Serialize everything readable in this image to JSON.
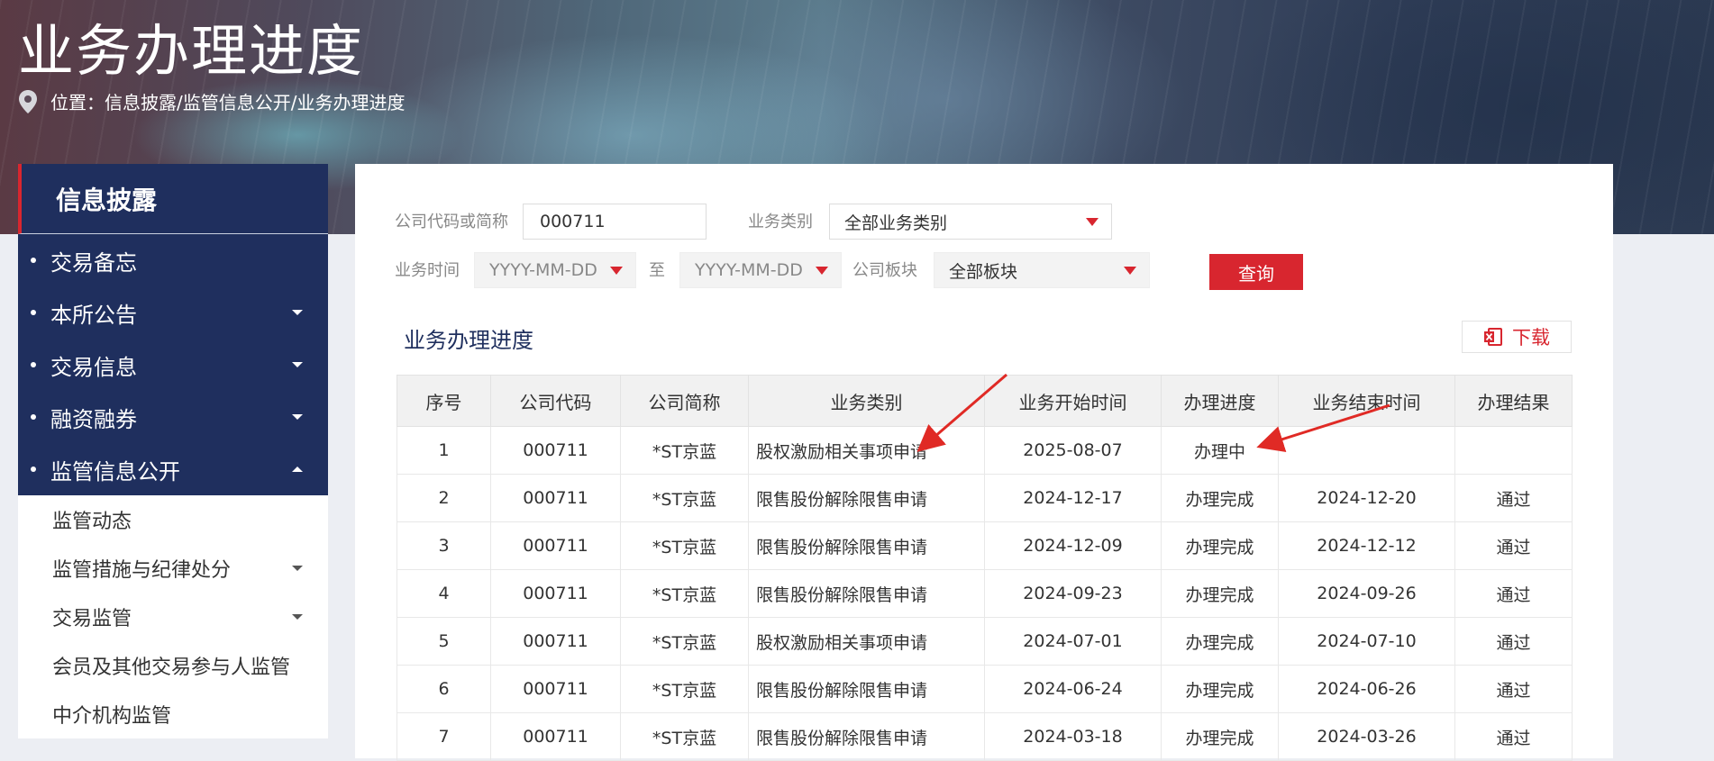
{
  "header": {
    "title": "业务办理进度",
    "breadcrumb": "位置：信息披露/监管信息公开/业务办理进度"
  },
  "sidebar": {
    "title": "信息披露",
    "items": [
      {
        "label": "交易备忘"
      },
      {
        "label": "本所公告"
      },
      {
        "label": "交易信息"
      },
      {
        "label": "融资融券"
      },
      {
        "label": "监管信息公开"
      }
    ],
    "subitems": [
      {
        "label": "监管动态"
      },
      {
        "label": "监管措施与纪律处分"
      },
      {
        "label": "交易监管"
      },
      {
        "label": "会员及其他交易参与人监管"
      },
      {
        "label": "中介机构监管"
      }
    ]
  },
  "filters": {
    "company_label": "公司代码或简称",
    "company_value": "000711",
    "type_label": "业务类别",
    "type_value": "全部业务类别",
    "time_label": "业务时间",
    "date_from_placeholder": "YYYY-MM-DD",
    "to_label": "至",
    "date_to_placeholder": "YYYY-MM-DD",
    "board_label": "公司板块",
    "board_value": "全部板块",
    "query_label": "查询"
  },
  "results": {
    "title": "业务办理进度",
    "download_label": "下载",
    "columns": [
      "序号",
      "公司代码",
      "公司简称",
      "业务类别",
      "业务开始时间",
      "办理进度",
      "业务结束时间",
      "办理结果"
    ],
    "rows": [
      [
        "1",
        "000711",
        "*ST京蓝",
        "股权激励相关事项申请",
        "2025-08-07",
        "办理中",
        "",
        ""
      ],
      [
        "2",
        "000711",
        "*ST京蓝",
        "限售股份解除限售申请",
        "2024-12-17",
        "办理完成",
        "2024-12-20",
        "通过"
      ],
      [
        "3",
        "000711",
        "*ST京蓝",
        "限售股份解除限售申请",
        "2024-12-09",
        "办理完成",
        "2024-12-12",
        "通过"
      ],
      [
        "4",
        "000711",
        "*ST京蓝",
        "限售股份解除限售申请",
        "2024-09-23",
        "办理完成",
        "2024-09-26",
        "通过"
      ],
      [
        "5",
        "000711",
        "*ST京蓝",
        "股权激励相关事项申请",
        "2024-07-01",
        "办理完成",
        "2024-07-10",
        "通过"
      ],
      [
        "6",
        "000711",
        "*ST京蓝",
        "限售股份解除限售申请",
        "2024-06-24",
        "办理完成",
        "2024-06-26",
        "通过"
      ],
      [
        "7",
        "000711",
        "*ST京蓝",
        "限售股份解除限售申请",
        "2024-03-18",
        "办理完成",
        "2024-03-26",
        "通过"
      ]
    ]
  },
  "colors": {
    "brand_navy": "#1f2f5e",
    "accent_red": "#d8262f",
    "annotation_arrow": "#e02a25"
  }
}
